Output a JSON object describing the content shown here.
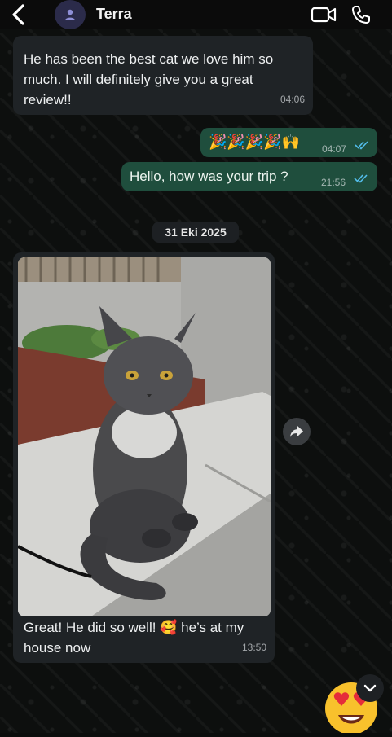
{
  "header": {
    "contact_name": "Terra"
  },
  "messages": [
    {
      "direction": "incoming",
      "text": "He has been the best cat we love him so much. I will definitely give you a great review!!",
      "time": "04:06"
    },
    {
      "direction": "outgoing",
      "text": "🎉🎉🎉🎉🙌",
      "time": "04:07",
      "status": "read"
    },
    {
      "direction": "outgoing",
      "text": "Hello, how was your trip ?",
      "time": "21:56",
      "status": "read"
    }
  ],
  "date_separator": "31 Eki 2025",
  "photo_message": {
    "direction": "incoming",
    "image": "photo of a grey long-haired cat sitting on a concrete ledge",
    "caption": "Great! He did so well! 🥰 he’s at my house now",
    "time": "13:50"
  },
  "reaction_emoji": "😍",
  "colors": {
    "incoming_bubble": "#1f2326",
    "outgoing_bubble": "#1f4e3d",
    "read_ticks": "#53bdeb",
    "background": "#0b0d0c"
  }
}
